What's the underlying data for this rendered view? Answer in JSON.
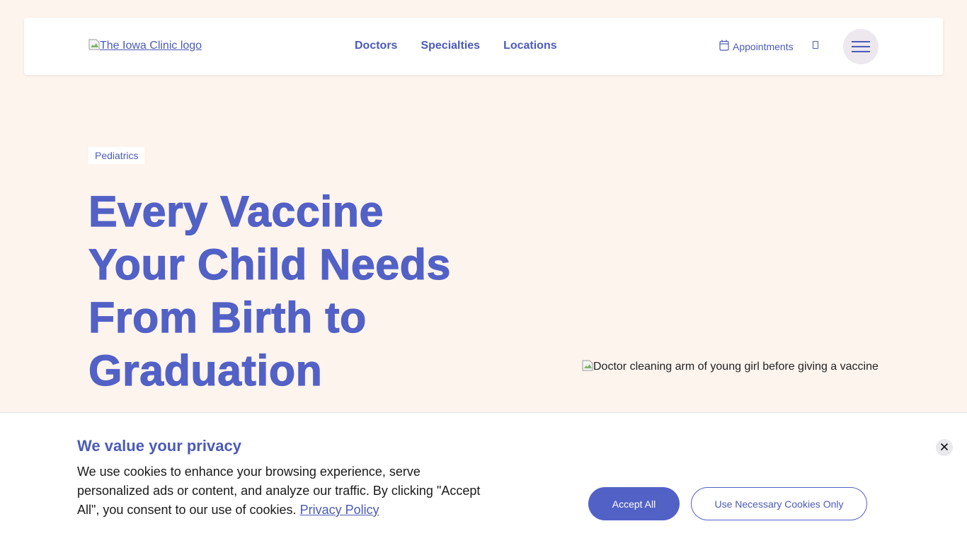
{
  "header": {
    "logo_alt": "The Iowa Clinic logo",
    "nav": [
      "Doctors",
      "Specialties",
      "Locations"
    ],
    "appointments_label": "Appointments"
  },
  "hero": {
    "tag": "Pediatrics",
    "title": "Every Vaccine Your Child Needs From Birth to Graduation",
    "image_alt": "Doctor cleaning arm of young girl before giving a vaccine"
  },
  "cookie_banner": {
    "title": "We value your privacy",
    "text": "We use cookies to enhance your browsing experience, serve personalized ads or content, and analyze our traffic. By clicking \"Accept All\", you consent to our use of cookies.",
    "privacy_link": "Privacy Policy",
    "accept_label": "Accept All",
    "necessary_label": "Use Necessary Cookies Only"
  },
  "colors": {
    "brand": "#5261c6",
    "page_background": "#fdf4ee"
  },
  "icons": {
    "appointments": "calendar-icon",
    "menu": "hamburger-icon",
    "close": "close-icon",
    "search": "search-icon"
  }
}
